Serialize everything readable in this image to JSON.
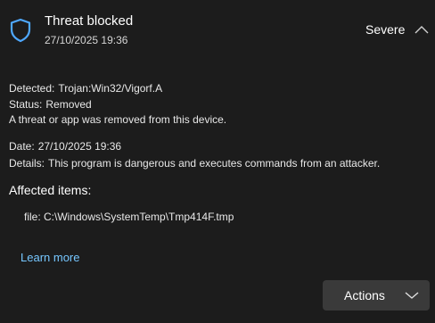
{
  "header": {
    "title": "Threat blocked",
    "timestamp": "27/10/2025 19:36",
    "severity": "Severe",
    "shield_icon": "shield-icon",
    "collapse_icon": "chevron-up-icon"
  },
  "details": {
    "detected_label": "Detected:",
    "detected_value": "Trojan:Win32/Vigorf.A",
    "status_label": "Status:",
    "status_value": "Removed",
    "status_message": "A threat or app was removed from this device.",
    "date_label": "Date:",
    "date_value": "27/10/2025 19:36",
    "details_label": "Details:",
    "details_value": "This program is dangerous and executes commands from an attacker."
  },
  "affected": {
    "heading": "Affected items:",
    "items": [
      "file: C:\\Windows\\SystemTemp\\Tmp414F.tmp"
    ]
  },
  "links": {
    "learn_more": "Learn more"
  },
  "actions": {
    "label": "Actions",
    "chevron_icon": "chevron-down-icon"
  },
  "colors": {
    "background": "#1c1c1c",
    "accent": "#4ea8ff",
    "link": "#76c7ff",
    "button": "#3a3a3a"
  }
}
